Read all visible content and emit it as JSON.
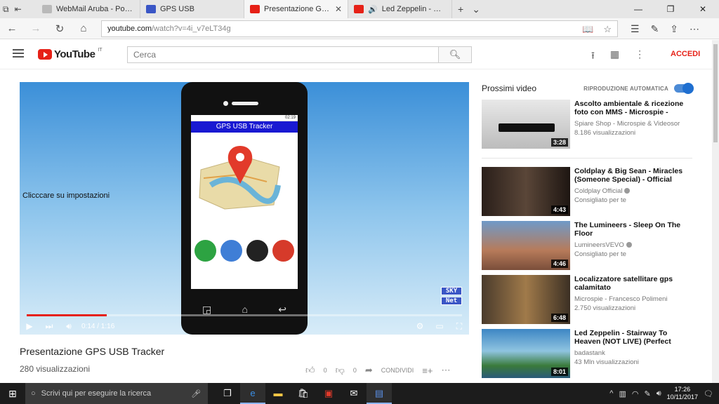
{
  "browser": {
    "tabs": [
      {
        "title": "WebMail Aruba - Posta in ar",
        "active": false
      },
      {
        "title": "GPS USB",
        "active": false
      },
      {
        "title": "Presentazione GPS USB",
        "active": true
      },
      {
        "title": "Led Zeppelin - Stairway",
        "active": false
      }
    ],
    "url_host": "youtube.com",
    "url_path": "/watch?v=4i_v7eLT34g"
  },
  "youtube": {
    "logo_text": "YouTube",
    "region": "IT",
    "search_placeholder": "Cerca",
    "signin_label": "ACCEDI"
  },
  "player": {
    "overlay_note": "Clicccare su impostazioni",
    "app_title": "GPS USB Tracker",
    "status_time": "02:19",
    "watermark_line1": "SKY",
    "watermark_line2": "Net",
    "time": "0:14 / 1:16",
    "progress_fraction": 0.184
  },
  "video": {
    "title": "Presentazione GPS USB Tracker",
    "views": "280 visualizzazioni",
    "likes": "0",
    "dislikes": "0",
    "share_label": "CONDIVIDI"
  },
  "sidebar": {
    "heading": "Prossimi video",
    "autoplay_label": "RIPRODUZIONE AUTOMATICA",
    "videos": [
      {
        "title": "Ascolto ambientale & ricezione foto con MMS - Microspie -",
        "channel": "Spiare Shop - Microspie & Videosor",
        "meta": "8.186 visualizzazioni",
        "duration": "3:28"
      },
      {
        "title": "Coldplay & Big Sean - Miracles (Someone Special) - Official",
        "channel": "Coldplay Official",
        "meta": "Consigliato per te",
        "duration": "4:43"
      },
      {
        "title": "The Lumineers - Sleep On The Floor",
        "channel": "LumineersVEVO",
        "meta": "Consigliato per te",
        "duration": "4:46"
      },
      {
        "title": "Localizzatore satellitare gps calamitato",
        "channel": "Microspie - Francesco Polimeni",
        "meta": "2.750 visualizzazioni",
        "duration": "6:48"
      },
      {
        "title": "Led Zeppelin - Stairway To Heaven (NOT LIVE) (Perfect",
        "channel": "badastank",
        "meta": "43 Mln visualizzazioni",
        "duration": "8:01"
      }
    ]
  },
  "taskbar": {
    "search_placeholder": "Scrivi qui per eseguire la ricerca",
    "time": "17:26",
    "date": "10/11/2017"
  }
}
